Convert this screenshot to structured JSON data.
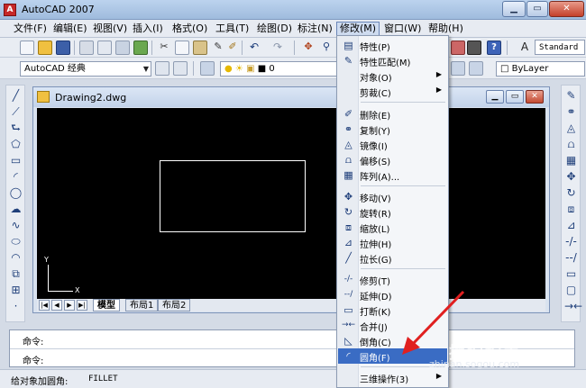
{
  "titlebar": {
    "title": "AutoCAD 2007",
    "icon": "autocad-icon",
    "controls": [
      "minimize",
      "maximize",
      "close"
    ]
  },
  "menubar": [
    "文件(F)",
    "编辑(E)",
    "视图(V)",
    "插入(I)",
    "格式(O)",
    "工具(T)",
    "绘图(D)",
    "标注(N)",
    "修改(M)",
    "窗口(W)",
    "帮助(H)"
  ],
  "menubar_active_index": 8,
  "toolbar": {
    "text_style": "Standard",
    "workspace": "AutoCAD 经典",
    "layer_value": "0",
    "color_value": "ByLayer"
  },
  "drawing_window": {
    "title": "Drawing2.dwg",
    "ucs_x": "X",
    "ucs_y": "Y",
    "tabs": [
      "模型",
      "布局1",
      "布局2"
    ]
  },
  "dropdown": {
    "items": [
      {
        "label": "特性(P)",
        "icon": "properties-icon"
      },
      {
        "label": "特性匹配(M)",
        "icon": "match-properties-icon"
      },
      {
        "label": "对象(O)",
        "icon": "",
        "submenu": true
      },
      {
        "label": "剪裁(C)",
        "icon": "",
        "submenu": true
      },
      {
        "label": "删除(E)",
        "icon": "erase-icon"
      },
      {
        "label": "复制(Y)",
        "icon": "copy-icon"
      },
      {
        "label": "镜像(I)",
        "icon": "mirror-icon"
      },
      {
        "label": "偏移(S)",
        "icon": "offset-icon"
      },
      {
        "label": "阵列(A)...",
        "icon": "array-icon"
      },
      {
        "label": "移动(V)",
        "icon": "move-icon"
      },
      {
        "label": "旋转(R)",
        "icon": "rotate-icon"
      },
      {
        "label": "缩放(L)",
        "icon": "scale-icon"
      },
      {
        "label": "拉伸(H)",
        "icon": "stretch-icon"
      },
      {
        "label": "拉长(G)",
        "icon": "lengthen-icon"
      },
      {
        "label": "修剪(T)",
        "icon": "trim-icon"
      },
      {
        "label": "延伸(D)",
        "icon": "extend-icon"
      },
      {
        "label": "打断(K)",
        "icon": "break-icon"
      },
      {
        "label": "合并(J)",
        "icon": "join-icon"
      },
      {
        "label": "倒角(C)",
        "icon": "chamfer-icon"
      },
      {
        "label": "圆角(F)",
        "icon": "fillet-icon",
        "highlighted": true
      },
      {
        "label": "三维操作(3)",
        "icon": "",
        "submenu": true
      }
    ]
  },
  "command": {
    "line1": "命令:",
    "line2": "命令:"
  },
  "status": {
    "text": "给对象加圆角:",
    "command": "FILLET"
  },
  "watermark": {
    "text": "搜狗指南",
    "url": "zhinan.sogou.com"
  },
  "colors": {
    "highlight": "#3a6cc4",
    "annotation_arrow": "#e02020",
    "canvas": "#000000"
  }
}
